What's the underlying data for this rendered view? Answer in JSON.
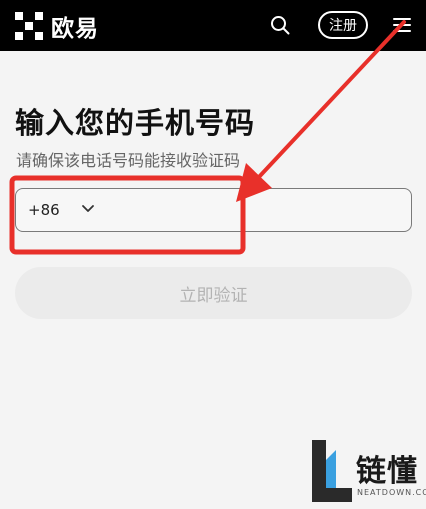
{
  "header": {
    "brand": "欧易",
    "search_icon": "search-icon",
    "register_label": "注册",
    "menu_icon": "hamburger-menu-icon"
  },
  "main": {
    "title": "输入您的手机号码",
    "subtitle": "请确保该电话号码能接收验证码",
    "phone_field": {
      "country_code": "+86",
      "value": ""
    },
    "verify_button_label": "立即验证"
  },
  "annotation": {
    "color": "#e8302a"
  },
  "watermark": {
    "text": "链懂",
    "domain": "NEATDOWN.COM"
  }
}
